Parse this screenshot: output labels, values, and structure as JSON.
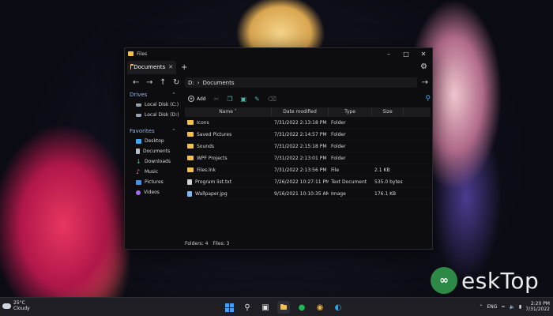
{
  "window": {
    "title": "Files"
  },
  "tabs": [
    {
      "label": "Documents"
    }
  ],
  "address": {
    "drive": "D:",
    "folder": "Documents"
  },
  "toolbar": {
    "add_label": "Add"
  },
  "sidebar": {
    "drives_header": "Drives",
    "drives": [
      {
        "label": "Local Disk (C:)"
      },
      {
        "label": "Local Disk (D:)"
      }
    ],
    "favorites_header": "Favorites",
    "favorites": [
      {
        "label": "Desktop",
        "icon": "desktop-icon"
      },
      {
        "label": "Documents",
        "icon": "documents-icon"
      },
      {
        "label": "Downloads",
        "icon": "downloads-icon"
      },
      {
        "label": "Music",
        "icon": "music-icon"
      },
      {
        "label": "Pictures",
        "icon": "pictures-icon"
      },
      {
        "label": "Videos",
        "icon": "videos-icon"
      }
    ]
  },
  "columns": {
    "name": "Name",
    "date": "Date modified",
    "type": "Type",
    "size": "Size"
  },
  "files": [
    {
      "name": "Icons",
      "date": "7/31/2022 2:13:18 PM",
      "type": "Folder",
      "size": ""
    },
    {
      "name": "Saved Pictures",
      "date": "7/31/2022 2:14:57 PM",
      "type": "Folder",
      "size": ""
    },
    {
      "name": "Sounds",
      "date": "7/31/2022 2:15:18 PM",
      "type": "Folder",
      "size": ""
    },
    {
      "name": "WPF Projects",
      "date": "7/31/2022 2:13:01 PM",
      "type": "Folder",
      "size": ""
    },
    {
      "name": "Files.lnk",
      "date": "7/31/2022 2:13:56 PM",
      "type": "File",
      "size": "2.1 KB"
    },
    {
      "name": "Program list.txt",
      "date": "7/26/2022 10:27:11 PM",
      "type": "Text Document",
      "size": "535.0 bytes"
    },
    {
      "name": "Wallpaper.jpg",
      "date": "9/16/2021 10:10:35 AM",
      "type": "Image",
      "size": "176.1 KB"
    }
  ],
  "status": {
    "folders": "Folders: 4",
    "files": "Files: 3"
  },
  "taskbar": {
    "weather_temp": "25°C",
    "weather_desc": "Cloudy",
    "language": "ENG",
    "time": "2:20 PM",
    "date": "7/31/2022"
  },
  "watermark": {
    "text": "eskTop"
  }
}
